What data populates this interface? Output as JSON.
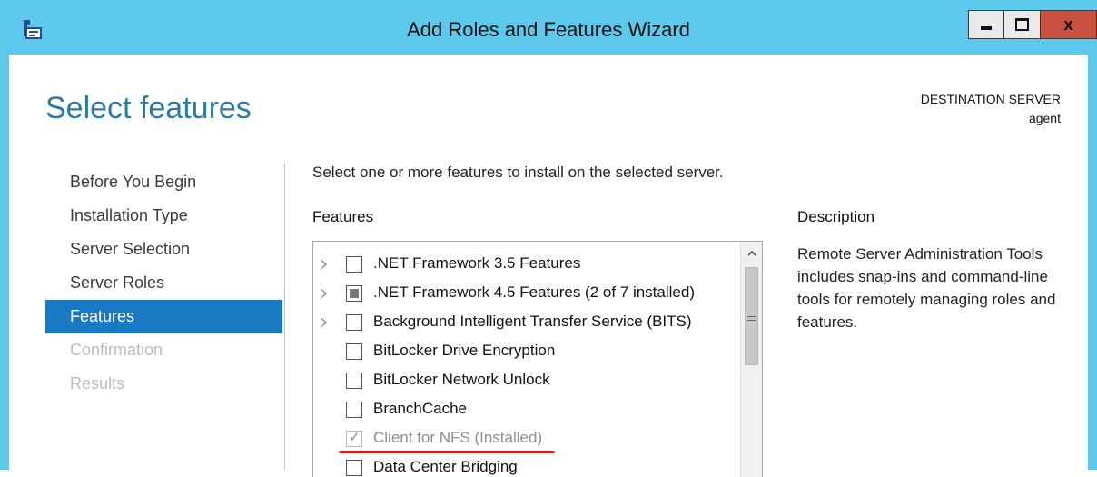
{
  "window": {
    "title": "Add Roles and Features Wizard",
    "controls": {
      "minimize": "minimize-icon",
      "maximize": "maximize-icon",
      "close": "x"
    }
  },
  "header": {
    "page_title": "Select features",
    "destination_label": "DESTINATION SERVER",
    "destination_value": "agent"
  },
  "nav": {
    "items": [
      {
        "label": "Before You Begin",
        "state": "normal"
      },
      {
        "label": "Installation Type",
        "state": "normal"
      },
      {
        "label": "Server Selection",
        "state": "normal"
      },
      {
        "label": "Server Roles",
        "state": "normal"
      },
      {
        "label": "Features",
        "state": "active"
      },
      {
        "label": "Confirmation",
        "state": "disabled"
      },
      {
        "label": "Results",
        "state": "disabled"
      }
    ]
  },
  "main": {
    "instruction": "Select one or more features to install on the selected server.",
    "features_heading": "Features",
    "features": [
      {
        "label": ".NET Framework 3.5 Features",
        "expandable": true,
        "checkbox": "unchecked"
      },
      {
        "label": ".NET Framework 4.5 Features (2 of 7 installed)",
        "expandable": true,
        "checkbox": "partial"
      },
      {
        "label": "Background Intelligent Transfer Service (BITS)",
        "expandable": true,
        "checkbox": "unchecked"
      },
      {
        "label": "BitLocker Drive Encryption",
        "expandable": false,
        "checkbox": "unchecked"
      },
      {
        "label": "BitLocker Network Unlock",
        "expandable": false,
        "checkbox": "unchecked"
      },
      {
        "label": "BranchCache",
        "expandable": false,
        "checkbox": "unchecked"
      },
      {
        "label": "Client for NFS (Installed)",
        "expandable": false,
        "checkbox": "checked-disabled"
      },
      {
        "label": "Data Center Bridging",
        "expandable": false,
        "checkbox": "unchecked"
      }
    ]
  },
  "description": {
    "heading": "Description",
    "text": "Remote Server Administration Tools includes snap-ins and command-line tools for remotely managing roles and features."
  },
  "colors": {
    "titlebar": "#5cc8ec",
    "accent": "#1979c3",
    "page_title": "#2b7aa4",
    "close_button": "#c7503f",
    "highlight_underline": "#d11b1b"
  }
}
